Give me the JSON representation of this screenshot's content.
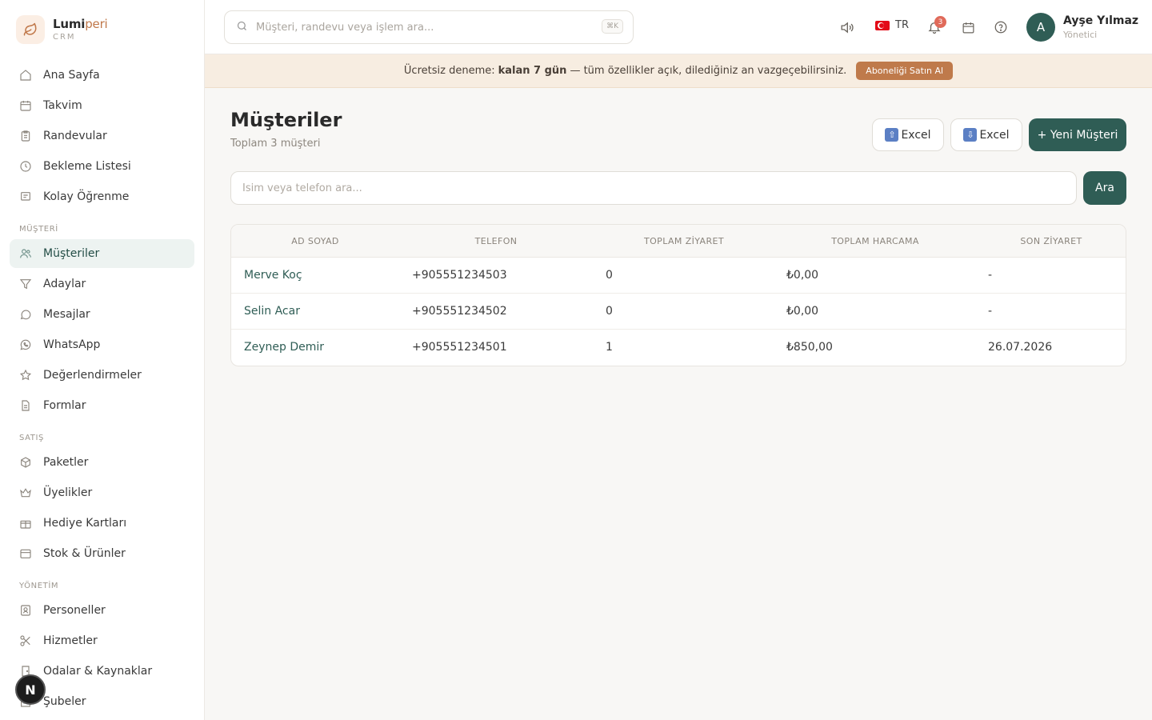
{
  "brand": {
    "name_main": "Lumi",
    "name_accent": "peri",
    "sub": "CRM"
  },
  "sidebar": {
    "items_top": [
      {
        "label": "Ana Sayfa",
        "icon": "home-icon"
      },
      {
        "label": "Takvim",
        "icon": "calendar-icon"
      },
      {
        "label": "Randevular",
        "icon": "clipboard-icon"
      },
      {
        "label": "Bekleme Listesi",
        "icon": "clock-icon"
      },
      {
        "label": "Kolay Öğrenme",
        "icon": "chat-square-icon"
      }
    ],
    "section_musteri": "MÜŞTERİ",
    "items_musteri": [
      {
        "label": "Müşteriler",
        "icon": "users-icon",
        "active": true
      },
      {
        "label": "Adaylar",
        "icon": "filter-icon"
      },
      {
        "label": "Mesajlar",
        "icon": "message-icon"
      },
      {
        "label": "WhatsApp",
        "icon": "whatsapp-icon"
      },
      {
        "label": "Değerlendirmeler",
        "icon": "star-icon"
      },
      {
        "label": "Formlar",
        "icon": "document-icon"
      }
    ],
    "section_satis": "SATIŞ",
    "items_satis": [
      {
        "label": "Paketler",
        "icon": "box-icon"
      },
      {
        "label": "Üyelikler",
        "icon": "crown-icon"
      },
      {
        "label": "Hediye Kartları",
        "icon": "gift-icon"
      },
      {
        "label": "Stok & Ürünler",
        "icon": "archive-icon"
      }
    ],
    "section_yonetim": "YÖNETİM",
    "items_yonetim": [
      {
        "label": "Personeller",
        "icon": "person-badge-icon"
      },
      {
        "label": "Hizmetler",
        "icon": "scissors-icon"
      },
      {
        "label": "Odalar & Kaynaklar",
        "icon": "door-icon"
      },
      {
        "label": "Şubeler",
        "icon": "building-icon"
      }
    ],
    "fab_label": "N"
  },
  "topbar": {
    "search_placeholder": "Müşteri, randevu veya işlem ara...",
    "shortcut": "⌘K",
    "lang": "TR",
    "notification_count": "3",
    "user_initial": "A",
    "user_name": "Ayşe Yılmaz",
    "user_role": "Yönetici"
  },
  "banner": {
    "prefix": "Ücretsiz deneme:",
    "highlight": "kalan 7 gün",
    "suffix": "— tüm özellikler açık, dilediğiniz an vazgeçebilirsiniz.",
    "button": "Aboneliği Satın Al"
  },
  "page": {
    "title": "Müşteriler",
    "subtitle": "Toplam 3 müşteri",
    "import_label": "Excel",
    "export_label": "Excel",
    "new_label": "+ Yeni Müşteri",
    "filter_placeholder": "İsim veya telefon ara...",
    "filter_button": "Ara"
  },
  "table": {
    "columns": [
      "AD SOYAD",
      "TELEFON",
      "TOPLAM ZİYARET",
      "TOPLAM HARCAMA",
      "SON ZİYARET"
    ],
    "rows": [
      {
        "name": "Merve Koç",
        "phone": "+905551234503",
        "visits": "0",
        "spend": "₺0,00",
        "last": "-"
      },
      {
        "name": "Selin Acar",
        "phone": "+905551234502",
        "visits": "0",
        "spend": "₺0,00",
        "last": "-"
      },
      {
        "name": "Zeynep Demir",
        "phone": "+905551234501",
        "visits": "1",
        "spend": "₺850,00",
        "last": "26.07.2026"
      }
    ]
  },
  "colors": {
    "primary": "#2f5d55",
    "accent": "#bf7a4b",
    "banner_bg": "#f7ede1"
  }
}
